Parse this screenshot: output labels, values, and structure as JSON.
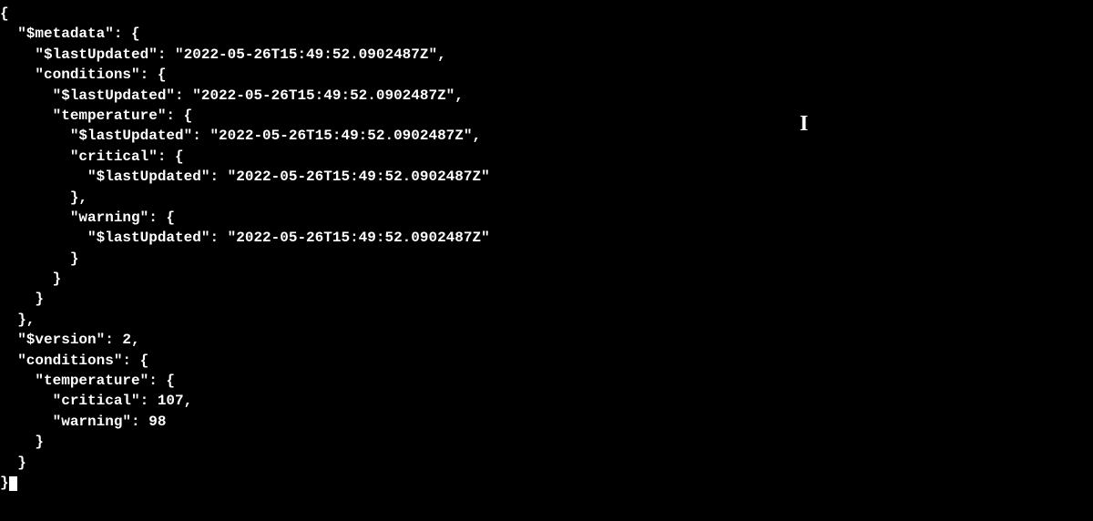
{
  "code": {
    "l01": "{",
    "l02": "  \"$metadata\": {",
    "l03": "    \"$lastUpdated\": \"2022-05-26T15:49:52.0902487Z\",",
    "l04": "    \"conditions\": {",
    "l05": "      \"$lastUpdated\": \"2022-05-26T15:49:52.0902487Z\",",
    "l06": "      \"temperature\": {",
    "l07": "        \"$lastUpdated\": \"2022-05-26T15:49:52.0902487Z\",",
    "l08": "        \"critical\": {",
    "l09": "          \"$lastUpdated\": \"2022-05-26T15:49:52.0902487Z\"",
    "l10": "        },",
    "l11": "        \"warning\": {",
    "l12": "          \"$lastUpdated\": \"2022-05-26T15:49:52.0902487Z\"",
    "l13": "        }",
    "l14": "      }",
    "l15": "    }",
    "l16": "  },",
    "l17": "  \"$version\": 2,",
    "l18": "  \"conditions\": {",
    "l19": "    \"temperature\": {",
    "l20": "      \"critical\": 107,",
    "l21": "      \"warning\": 98",
    "l22": "    }",
    "l23": "  }",
    "l24": "}"
  },
  "cursor_char": "I"
}
